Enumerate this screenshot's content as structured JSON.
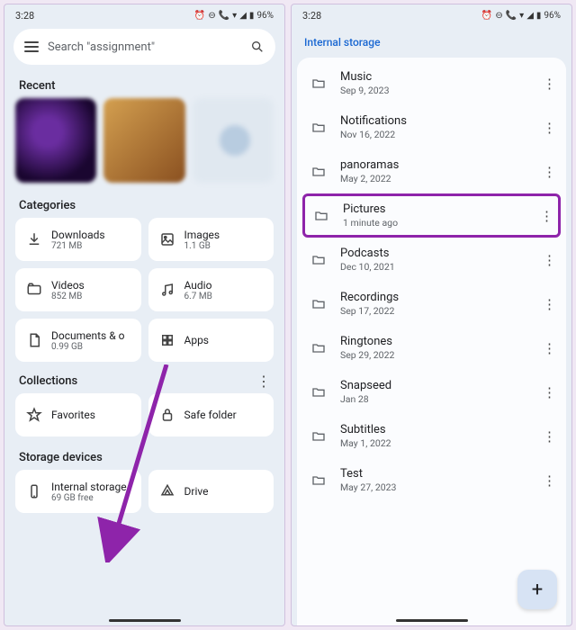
{
  "status": {
    "time": "3:28",
    "battery": "96%"
  },
  "left": {
    "search_placeholder": "Search \"assignment\"",
    "recent_title": "Recent",
    "categories_title": "Categories",
    "categories": [
      {
        "name": "Downloads",
        "sub": "721 MB"
      },
      {
        "name": "Images",
        "sub": "1.1 GB"
      },
      {
        "name": "Videos",
        "sub": "852 MB"
      },
      {
        "name": "Audio",
        "sub": "6.7 MB"
      },
      {
        "name": "Documents & o",
        "sub": "0.99 GB"
      },
      {
        "name": "Apps",
        "sub": ""
      }
    ],
    "collections_title": "Collections",
    "collections": [
      {
        "name": "Favorites"
      },
      {
        "name": "Safe folder"
      }
    ],
    "storage_title": "Storage devices",
    "storage": [
      {
        "name": "Internal storage",
        "sub": "69 GB free"
      },
      {
        "name": "Drive",
        "sub": ""
      }
    ]
  },
  "right": {
    "breadcrumb": "Internal storage",
    "folders": [
      {
        "name": "Music",
        "date": "Sep 9, 2023"
      },
      {
        "name": "Notifications",
        "date": "Nov 16, 2022"
      },
      {
        "name": "panoramas",
        "date": "May 2, 2022"
      },
      {
        "name": "Pictures",
        "date": "1 minute ago",
        "highlight": true
      },
      {
        "name": "Podcasts",
        "date": "Dec 10, 2021"
      },
      {
        "name": "Recordings",
        "date": "Sep 17, 2022"
      },
      {
        "name": "Ringtones",
        "date": "Sep 29, 2022"
      },
      {
        "name": "Snapseed",
        "date": "Jan 28"
      },
      {
        "name": "Subtitles",
        "date": "May 1, 2022"
      },
      {
        "name": "Test",
        "date": "May 27, 2023"
      }
    ],
    "fab": "+"
  }
}
